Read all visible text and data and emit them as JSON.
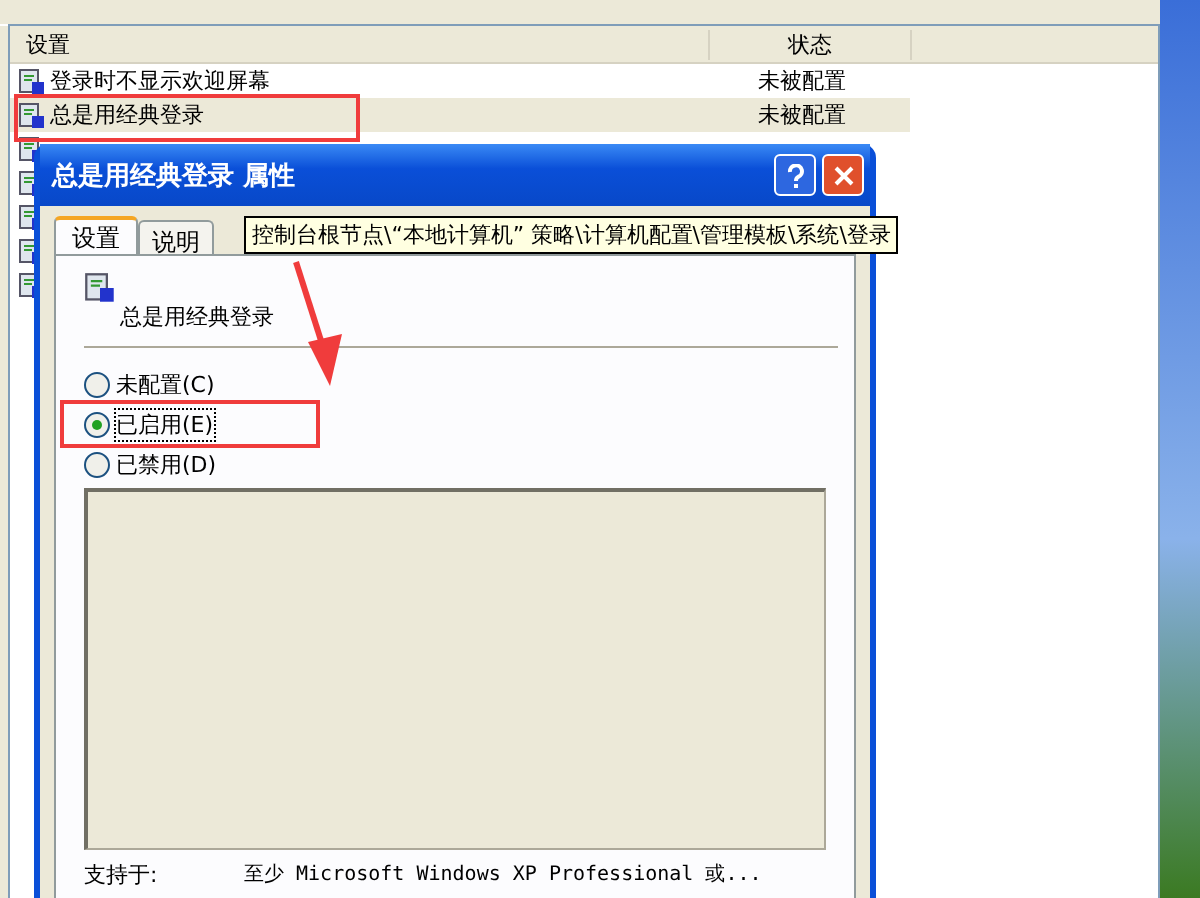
{
  "list": {
    "columns": [
      "设置",
      "状态"
    ],
    "rows": [
      {
        "name": "登录时不显示欢迎屏幕",
        "status": "未被配置",
        "selected": false
      },
      {
        "name": "总是用经典登录",
        "status": "未被配置",
        "selected": true
      }
    ],
    "covered_rows": [
      {
        "selected": false
      },
      {
        "selected": false
      },
      {
        "selected": false
      },
      {
        "selected": false
      },
      {
        "selected": false
      }
    ]
  },
  "dialog": {
    "title": "总是用经典登录 属性",
    "tabs": [
      {
        "label": "设置",
        "selected": true
      },
      {
        "label": "说明",
        "selected": false
      }
    ],
    "tooltip": "控制台根节点\\“本地计算机” 策略\\计算机配置\\管理模板\\系统\\登录",
    "setting_name": "总是用经典登录",
    "options": [
      {
        "label": "未配置(C)",
        "selected": false
      },
      {
        "label": "已启用(E)",
        "selected": true
      },
      {
        "label": "已禁用(D)",
        "selected": false
      }
    ],
    "supported_label": "支持于:",
    "supported_value": "至少 Microsoft Windows XP Professional 或..."
  }
}
